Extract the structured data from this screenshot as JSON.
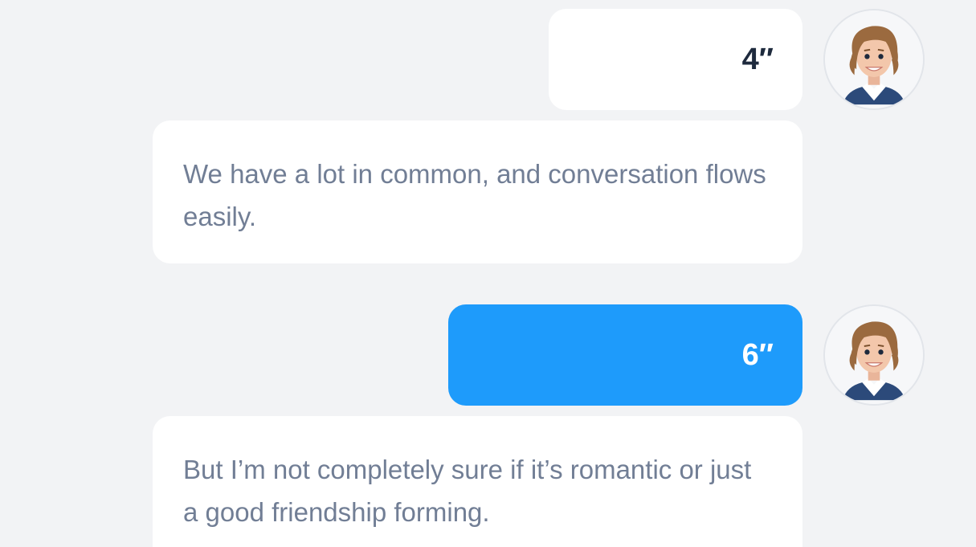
{
  "conversation": {
    "messages": [
      {
        "role": "option",
        "text": "4″",
        "selected": false
      },
      {
        "role": "statement",
        "text": "We have a lot in common, and conversation flows easily."
      },
      {
        "role": "option",
        "text": "6″",
        "selected": true
      },
      {
        "role": "statement",
        "text": "But I’m not completely sure if it’s romantic or just a good friendship forming."
      }
    ]
  },
  "colors": {
    "background": "#f2f3f5",
    "bubble": "#ffffff",
    "selected_bubble": "#1e9bfb",
    "statement_text": "#717e95",
    "option_text": "#1e2a3d"
  },
  "icons": {
    "avatar": "user-avatar-icon"
  }
}
